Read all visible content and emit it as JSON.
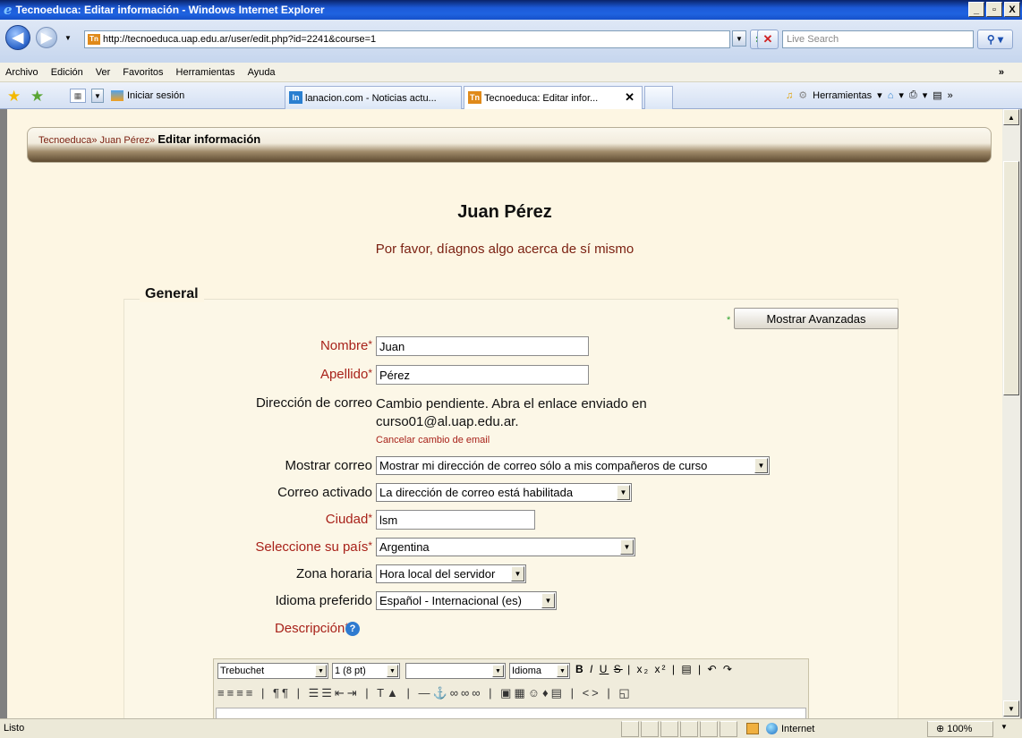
{
  "window": {
    "title": "Tecnoeduca: Editar información - Windows Internet Explorer",
    "minimize": "_",
    "restore": "▫",
    "close": "X"
  },
  "address": {
    "url": "http://tecnoeduca.uap.edu.ar/user/edit.php?id=2241&course=1",
    "search_placeholder": "Live Search"
  },
  "menu": {
    "items": [
      "Archivo",
      "Edición",
      "Ver",
      "Favoritos",
      "Herramientas",
      "Ayuda"
    ]
  },
  "tabs": {
    "favorites_bar": [
      "Iniciar sesión"
    ],
    "items": [
      {
        "label": "lanacion.com - Noticias actu..."
      },
      {
        "label": "Tecnoeduca: Editar infor..."
      }
    ],
    "tools_label": "Herramientas"
  },
  "breadcrumb": {
    "home": "Tecnoeduca",
    "user": "Juan Pérez",
    "current": "Editar información",
    "sep": "»"
  },
  "page": {
    "heading": "Juan Pérez",
    "intro": "Por favor, díagnos algo acerca de sí mismo",
    "section_title": "General",
    "advanced_button": "Mostrar Avanzadas"
  },
  "form": {
    "nombre_label": "Nombre",
    "nombre_value": "Juan",
    "apellido_label": "Apellido",
    "apellido_value": "Pérez",
    "email_label": "Dirección de correo",
    "email_line1": "Cambio pendiente. Abra el enlace enviado en",
    "email_line2": "curso01@al.uap.edu.ar.",
    "cancel_email": "Cancelar cambio de email",
    "mostrar_label": "Mostrar correo",
    "mostrar_value": "Mostrar mi dirección de correo sólo a mis compañeros de curso",
    "activado_label": "Correo activado",
    "activado_value": "La dirección de correo está habilitada",
    "ciudad_label": "Ciudad",
    "ciudad_value": "lsm",
    "pais_label": "Seleccione su país",
    "pais_value": "Argentina",
    "zona_label": "Zona horaria",
    "zona_value": "Hora local del servidor",
    "idioma_label": "Idioma preferido",
    "idioma_value": "Español - Internacional (es)",
    "descripcion_label": "Descripción",
    "required_mark": "*"
  },
  "editor": {
    "font": "Trebuchet",
    "size": "1 (8 pt)",
    "format": "",
    "lang": "Idioma"
  },
  "status": {
    "text": "Listo",
    "zone": "Internet",
    "zoom": "100%"
  }
}
